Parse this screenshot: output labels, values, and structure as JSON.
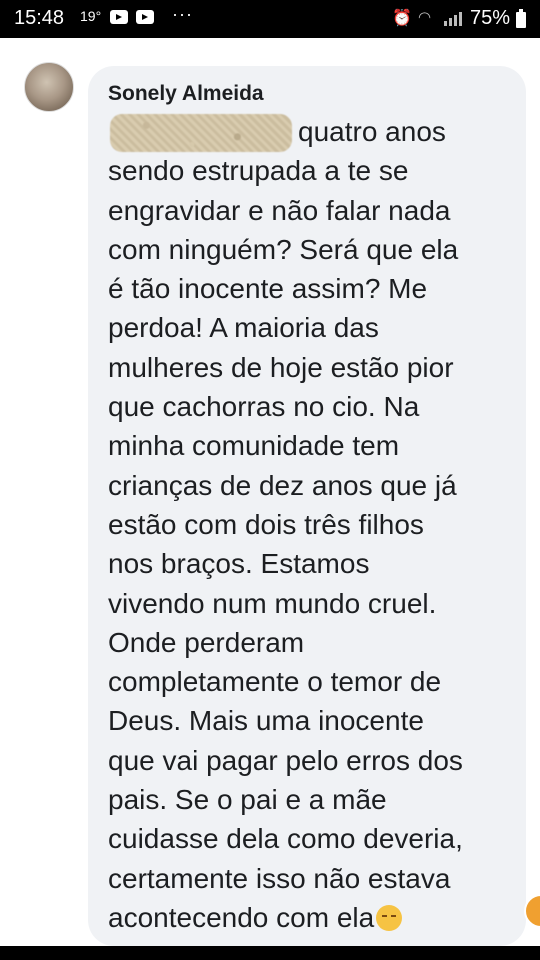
{
  "status_bar": {
    "time": "15:48",
    "temperature": "19°",
    "battery": "75%"
  },
  "comment": {
    "author": "Sonely Almeida",
    "lines": [
      "quatro anos",
      "sendo estrupada a te se",
      "engravidar e não falar nada",
      "com ninguém? Será que ela",
      "é tão inocente assim? Me",
      "perdoa! A maioria das",
      "mulheres de hoje estão pior",
      "que cachorras no cio. Na",
      "minha comunidade tem",
      "crianças de dez anos que já",
      "estão com dois três filhos",
      "nos braços. Estamos",
      "vivendo num mundo cruel.",
      "Onde perderam",
      "completamente o temor de",
      "Deus. Mais uma inocente",
      "que vai pagar pelo erros dos",
      "pais. Se o pai e a mãe",
      "cuidasse dela como deveria,",
      "certamente isso não estava",
      "acontecendo com ela"
    ],
    "trailing_emoji": "sad-face-emoji"
  },
  "colors": {
    "bubble": "#f0f2f5",
    "text": "#1c1e21",
    "status_bar": "#000000"
  }
}
